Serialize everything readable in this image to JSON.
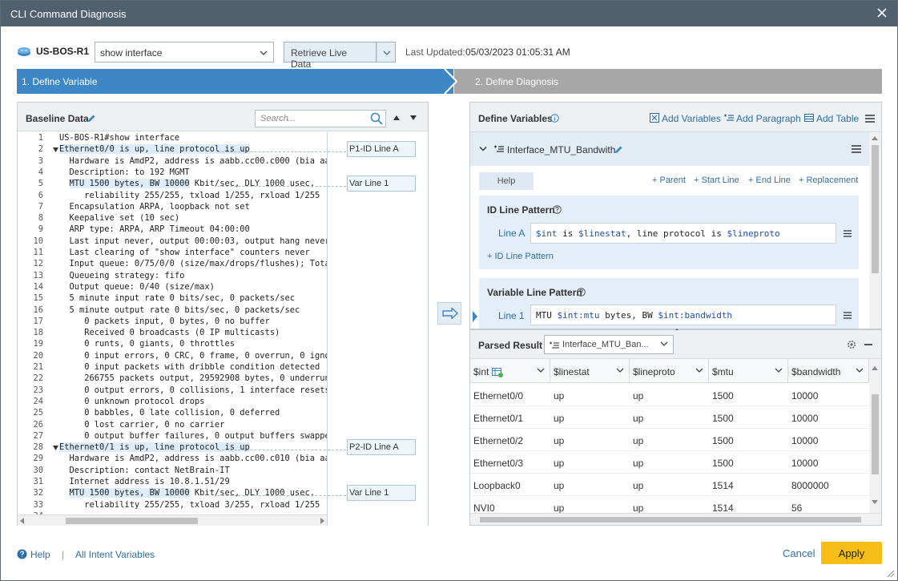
{
  "window": {
    "title": "CLI Command Diagnosis"
  },
  "topbar": {
    "device_name": "US-BOS-R1",
    "command_value": "show interface",
    "retrieve_label": "Retrieve Live Data",
    "last_updated_label": "Last Updated:",
    "last_updated_value": "05/03/2023 01:05:31 AM"
  },
  "steps": [
    {
      "label": "1. Define Variable",
      "active": true
    },
    {
      "label": "2. Define Diagnosis",
      "active": false
    }
  ],
  "baseline": {
    "title": "Baseline Data",
    "search_placeholder": "Search...",
    "lines": [
      {
        "n": "1",
        "text": "US-BOS-R1#show interface",
        "indent": 0
      },
      {
        "n": "2",
        "text": "Ethernet0/0 is up, line protocol is up",
        "indent": 0,
        "hl": true
      },
      {
        "n": "3",
        "text": "  Hardware is AmdP2, address is aabb.cc00.c000 (bia aabb",
        "indent": 0
      },
      {
        "n": "4",
        "text": "  Description: to 192 MGMT",
        "indent": 0
      },
      {
        "n": "5",
        "text": "  MTU 1500 bytes, BW 10000 Kbit/sec, DLY 1000 usec,",
        "indent": 0,
        "hlpart": "MTU 1500 bytes, BW 10000"
      },
      {
        "n": "6",
        "text": "     reliability 255/255, txload 1/255, rxload 1/255",
        "indent": 0
      },
      {
        "n": "7",
        "text": "  Encapsulation ARPA, loopback not set",
        "indent": 0
      },
      {
        "n": "8",
        "text": "  Keepalive set (10 sec)",
        "indent": 0
      },
      {
        "n": "9",
        "text": "  ARP type: ARPA, ARP Timeout 04:00:00",
        "indent": 0
      },
      {
        "n": "10",
        "text": "  Last input never, output 00:00:03, output hang never",
        "indent": 0
      },
      {
        "n": "11",
        "text": "  Last clearing of \"show interface\" counters never",
        "indent": 0
      },
      {
        "n": "12",
        "text": "  Input queue: 0/75/0/0 (size/max/drops/flushes); Total o",
        "indent": 0
      },
      {
        "n": "13",
        "text": "  Queueing strategy: fifo",
        "indent": 0
      },
      {
        "n": "14",
        "text": "  Output queue: 0/40 (size/max)",
        "indent": 0
      },
      {
        "n": "15",
        "text": "  5 minute input rate 0 bits/sec, 0 packets/sec",
        "indent": 0
      },
      {
        "n": "16",
        "text": "  5 minute output rate 0 bits/sec, 0 packets/sec",
        "indent": 0
      },
      {
        "n": "17",
        "text": "     0 packets input, 0 bytes, 0 no buffer",
        "indent": 0
      },
      {
        "n": "18",
        "text": "     Received 0 broadcasts (0 IP multicasts)",
        "indent": 0
      },
      {
        "n": "19",
        "text": "     0 runts, 0 giants, 0 throttles",
        "indent": 0
      },
      {
        "n": "20",
        "text": "     0 input errors, 0 CRC, 0 frame, 0 overrun, 0 ignored",
        "indent": 0
      },
      {
        "n": "21",
        "text": "     0 input packets with dribble condition detected",
        "indent": 0
      },
      {
        "n": "22",
        "text": "     266755 packets output, 29592908 bytes, 0 underruns",
        "indent": 0
      },
      {
        "n": "23",
        "text": "     0 output errors, 0 collisions, 1 interface resets",
        "indent": 0
      },
      {
        "n": "24",
        "text": "     0 unknown protocol drops",
        "indent": 0
      },
      {
        "n": "25",
        "text": "     0 babbles, 0 late collision, 0 deferred",
        "indent": 0
      },
      {
        "n": "26",
        "text": "     0 lost carrier, 0 no carrier",
        "indent": 0
      },
      {
        "n": "27",
        "text": "     0 output buffer failures, 0 output buffers swapped o",
        "indent": 0
      },
      {
        "n": "28",
        "text": "Ethernet0/1 is up, line protocol is up",
        "indent": 0,
        "hl": true
      },
      {
        "n": "29",
        "text": "  Hardware is AmdP2, address is aabb.cc00.c010 (bia aabb",
        "indent": 0
      },
      {
        "n": "30",
        "text": "  Description: contact NetBrain-IT",
        "indent": 0
      },
      {
        "n": "31",
        "text": "  Internet address is 10.8.1.51/29",
        "indent": 0
      },
      {
        "n": "32",
        "text": "  MTU 1500 bytes, BW 10000 Kbit/sec, DLY 1000 usec,",
        "indent": 0,
        "hlpart": "MTU 1500 bytes, BW 10000"
      },
      {
        "n": "33",
        "text": "     reliability 255/255, txload 3/255, rxload 1/255",
        "indent": 0
      },
      {
        "n": "34",
        "text": "",
        "indent": 0
      }
    ],
    "annotations": [
      {
        "label": "P1-ID Line A",
        "line": 2
      },
      {
        "label": "Var Line 1",
        "line": 5
      },
      {
        "label": "P2-ID Line A",
        "line": 28
      },
      {
        "label": "Var Line 1",
        "line": 32
      }
    ]
  },
  "define_vars": {
    "title": "Define Variables",
    "add_variables": "Add Variables",
    "add_paragraph": "Add Paragraph",
    "add_table": "Add Table",
    "variable_name": "Interface_MTU_Bandwith",
    "help_label": "Help",
    "links": [
      "+ Parent",
      "+ Start Line",
      "+ End Line",
      "+ Replacement"
    ],
    "id_pattern": {
      "title": "ID Line Pattern",
      "line_label": "Line A",
      "value": "$int is $linestat, line protocol is $lineproto",
      "add_label": "+ ID Line Pattern"
    },
    "var_pattern": {
      "title": "Variable Line Pattern",
      "line_label": "Line 1",
      "value": "MTU $int:mtu bytes, BW $int:bandwidth"
    }
  },
  "parsed": {
    "title": "Parsed Result",
    "selected": "Interface_MTU_Ban...",
    "columns": [
      "$int",
      "$linestat",
      "$lineproto",
      "$mtu",
      "$bandwidth"
    ],
    "rows": [
      [
        "Ethernet0/0",
        "up",
        "up",
        "1500",
        "10000"
      ],
      [
        "Ethernet0/1",
        "up",
        "up",
        "1500",
        "10000"
      ],
      [
        "Ethernet0/2",
        "up",
        "up",
        "1500",
        "10000"
      ],
      [
        "Ethernet0/3",
        "up",
        "up",
        "1500",
        "10000"
      ],
      [
        "Loopback0",
        "up",
        "up",
        "1514",
        "8000000"
      ],
      [
        "NVI0",
        "up",
        "up",
        "1514",
        "56"
      ]
    ]
  },
  "footer": {
    "help": "Help",
    "all_intent": "All Intent Variables",
    "cancel": "Cancel",
    "apply": "Apply"
  },
  "colors": {
    "accent": "#3e87c7",
    "apply": "#f6bd16",
    "titlebar": "#50606f",
    "link": "#2e6ea6"
  }
}
